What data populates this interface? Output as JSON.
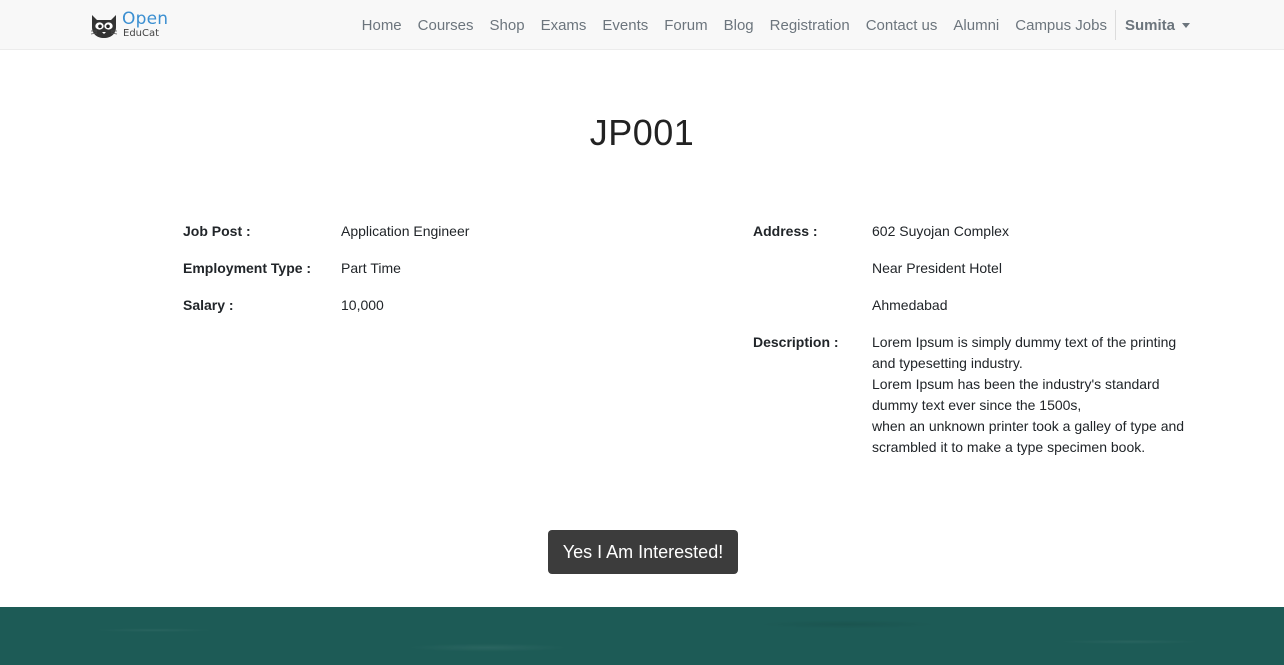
{
  "brand": {
    "line1": "Open",
    "line2": "EduCat",
    "primary_color": "#3b8fd1"
  },
  "nav": {
    "items": [
      "Home",
      "Courses",
      "Shop",
      "Exams",
      "Events",
      "Forum",
      "Blog",
      "Registration",
      "Contact us",
      "Alumni",
      "Campus Jobs"
    ],
    "user": "Sumita",
    "user_icon": "chevron-down-icon"
  },
  "job": {
    "code": "JP001",
    "post_label": "Job Post :",
    "post_value": "Application Engineer",
    "employment_label": "Employment Type :",
    "employment_value": "Part Time",
    "salary_label": "Salary :",
    "salary_value": "10,000",
    "address_label": "Address :",
    "address_lines": [
      "602 Suyojan Complex",
      "Near President Hotel",
      "Ahmedabad"
    ],
    "description_label": "Description :",
    "description_lines": [
      "Lorem Ipsum is simply dummy text of the printing and typesetting industry.",
      "Lorem Ipsum has been the industry's standard dummy text ever since the 1500s,",
      "when an unknown printer took a galley of type and scrambled it to make a type specimen book."
    ]
  },
  "cta": {
    "label": "Yes I Am Interested!",
    "color": "#3c3c3c"
  },
  "footer": {
    "color": "#1d5b56"
  }
}
